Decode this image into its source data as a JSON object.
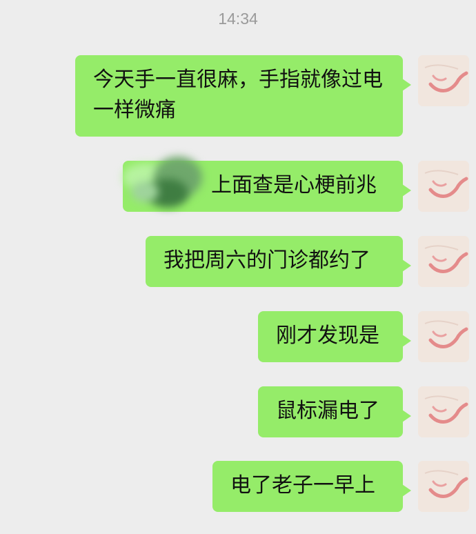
{
  "chat": {
    "timestamp": "14:34",
    "messages": [
      {
        "line1": "今天手一直很麻，手指就像过电",
        "line2": "一样微痛"
      },
      {
        "text": "上面查是心梗前兆"
      },
      {
        "text": "我把周六的门诊都约了"
      },
      {
        "text": "刚才发现是"
      },
      {
        "text": "鼠标漏电了"
      },
      {
        "text": "电了老子一早上"
      }
    ]
  },
  "colors": {
    "bubble_outgoing": "#95ec69",
    "background": "#ededed",
    "timestamp": "#9a9a9a"
  },
  "icons": {
    "avatar": "pink-sketch-avatar-icon"
  }
}
